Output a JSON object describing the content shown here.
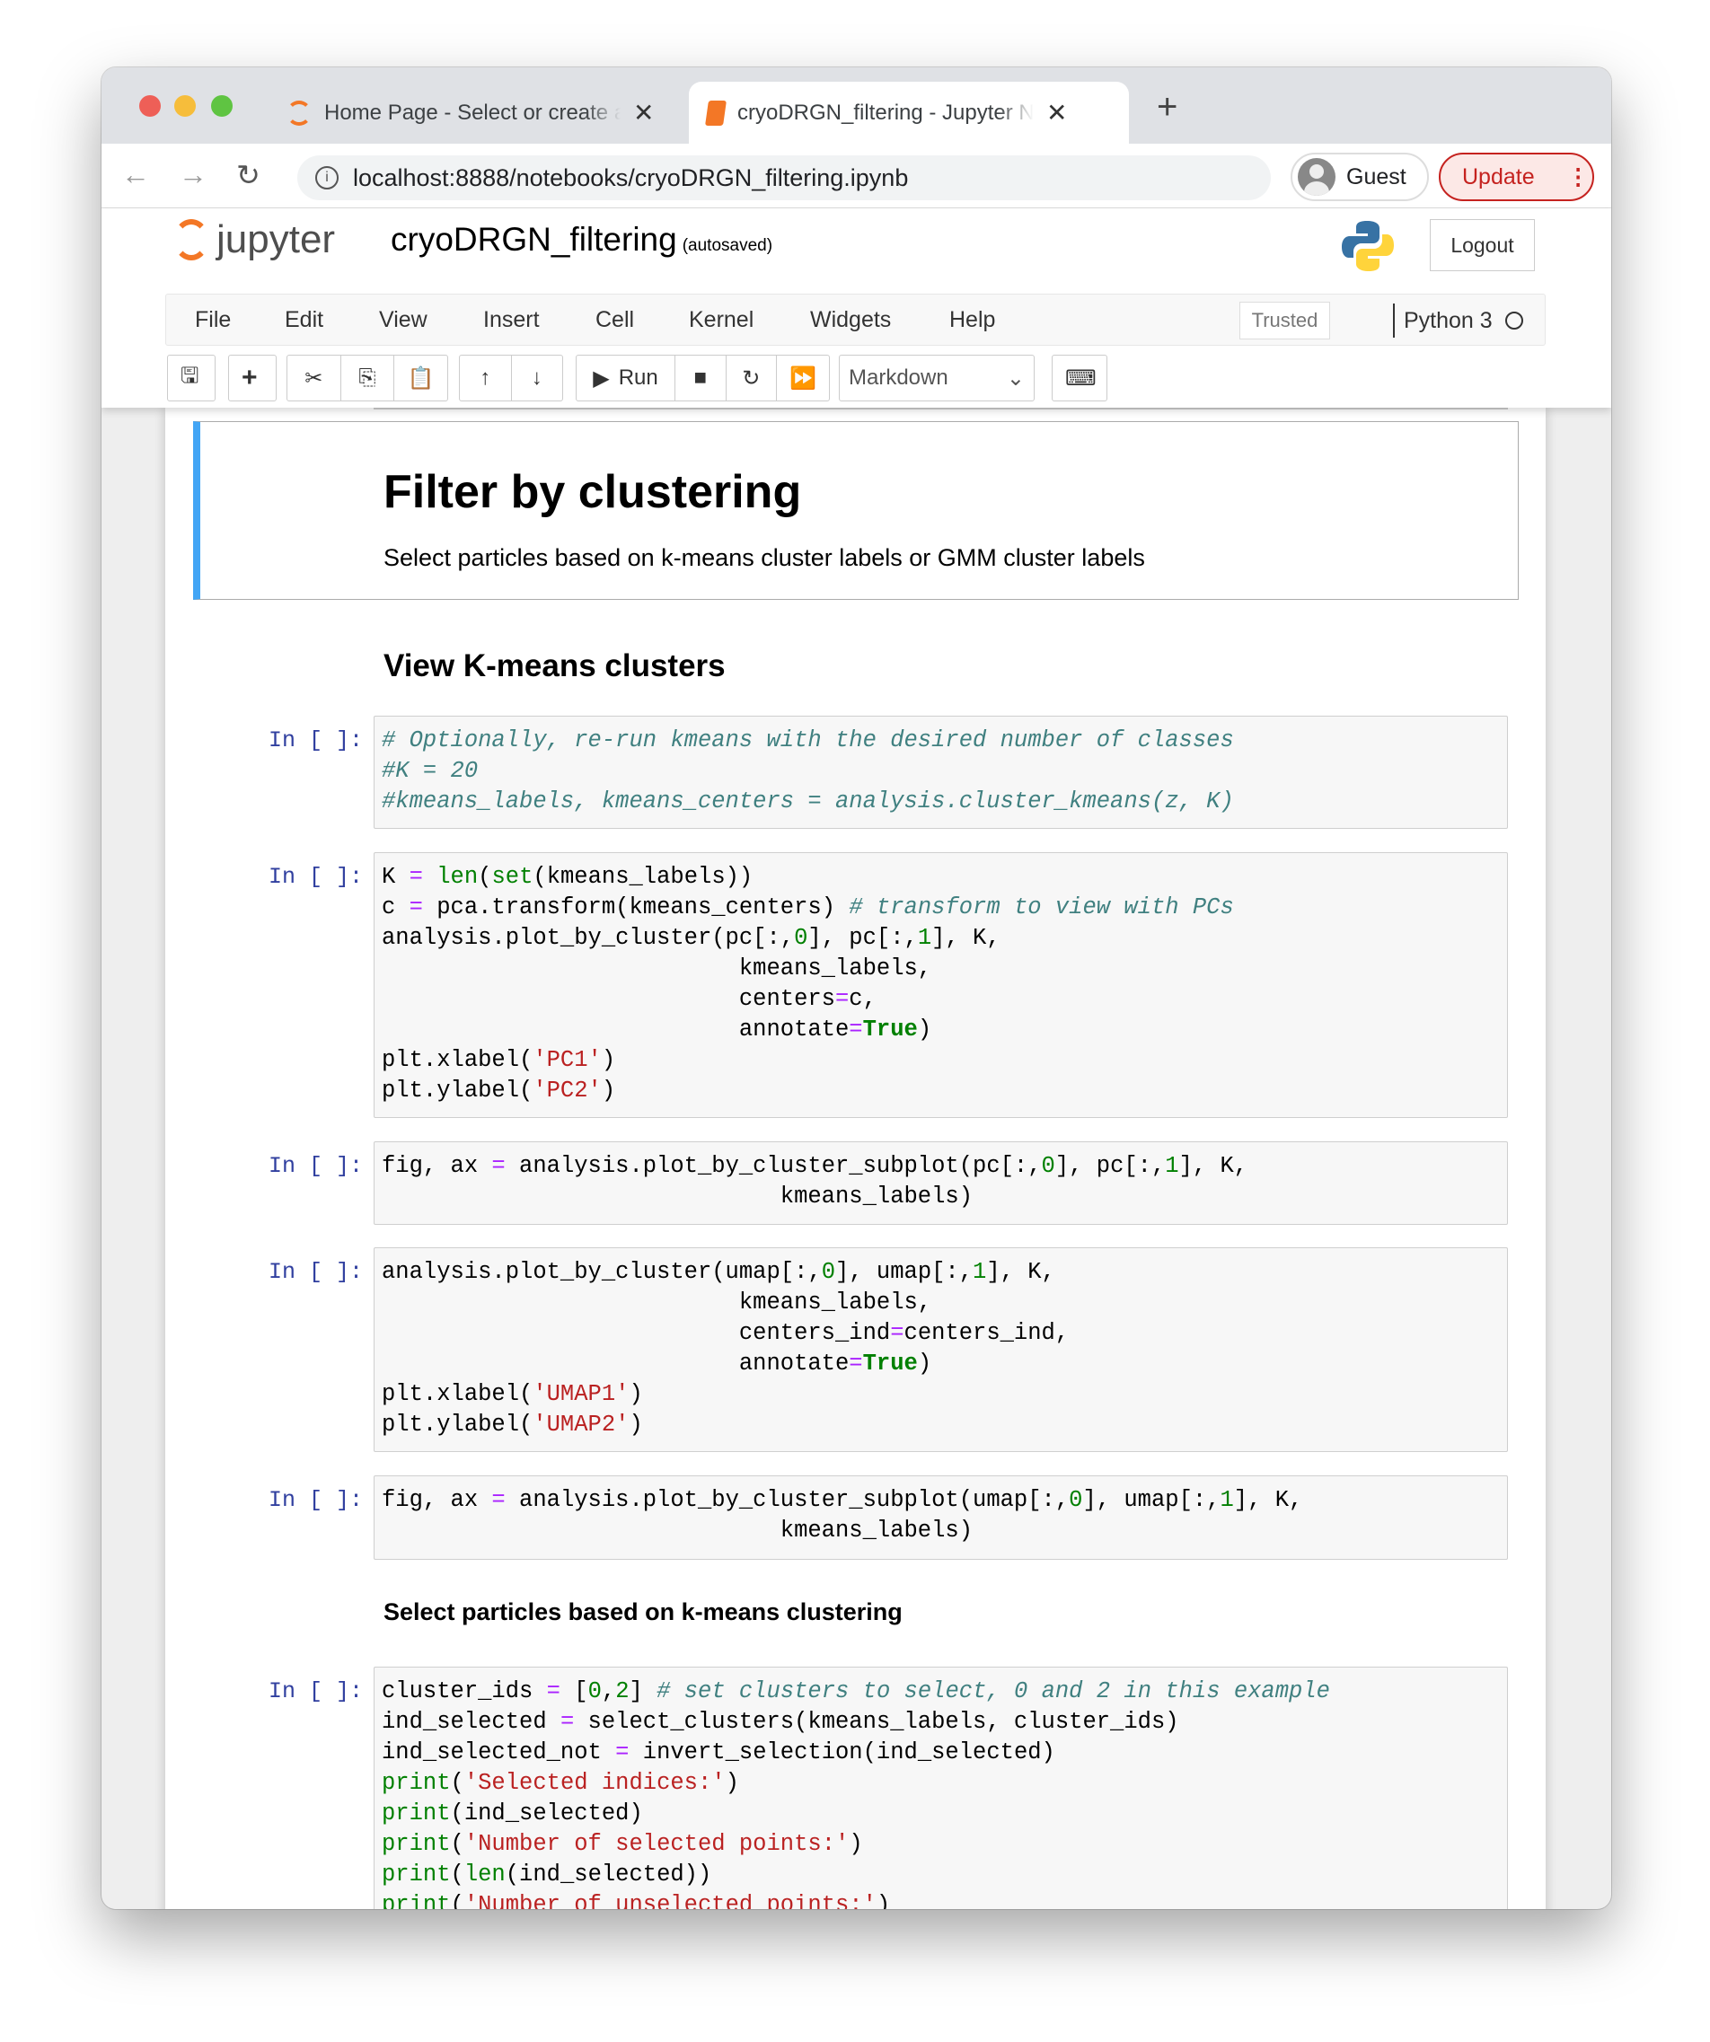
{
  "browser": {
    "tabs": [
      {
        "title": "Home Page - Select or create a notebook",
        "close": "✕"
      },
      {
        "title": "cryoDRGN_filtering - Jupyter Notebook",
        "close": "✕"
      }
    ],
    "new_tab": "+",
    "url": "localhost:8888/notebooks/cryoDRGN_filtering.ipynb",
    "profile": "Guest",
    "update": "Update",
    "nav": {
      "back": "←",
      "forward": "→",
      "reload": "↻",
      "menu": "⋮"
    }
  },
  "jupyter": {
    "logo_text": "jupyter",
    "notebook_name": "cryoDRGN_filtering",
    "save_status": "(autosaved)",
    "logout": "Logout",
    "menu": [
      "File",
      "Edit",
      "View",
      "Insert",
      "Cell",
      "Kernel",
      "Widgets",
      "Help"
    ],
    "trusted": "Trusted",
    "kernel": "Python 3",
    "toolbar": {
      "run": "Run",
      "cell_type": "Markdown"
    }
  },
  "colors": {
    "accent": "#42a5f5",
    "prompt": "#303f9f",
    "comment": "#408080",
    "string": "#ba2121",
    "builtin": "#008000",
    "operator": "#aa22ff",
    "update": "#c5221f"
  },
  "markdown": {
    "title": "Filter by clustering",
    "text": "Select particles based on k-means cluster labels or GMM cluster labels"
  },
  "headings": {
    "kmeans": "View K-means clusters",
    "select": "Select particles based on k-means clustering"
  },
  "prompt": "In [ ]:",
  "cells": [
    {
      "lines": [
        [
          [
            "c",
            "# Optionally, re-run kmeans with the desired number of classes"
          ]
        ],
        [
          [
            "c",
            "#K = 20"
          ]
        ],
        [
          [
            "c",
            "#kmeans_labels, kmeans_centers = analysis.cluster_kmeans(z, K)"
          ]
        ]
      ]
    },
    {
      "lines": [
        [
          [
            "n",
            "K "
          ],
          [
            "o",
            "="
          ],
          [
            "n",
            " "
          ],
          [
            "bi",
            "len"
          ],
          [
            "n",
            "("
          ],
          [
            "bi",
            "set"
          ],
          [
            "n",
            "(kmeans_labels))"
          ]
        ],
        [
          [
            "n",
            "c "
          ],
          [
            "o",
            "="
          ],
          [
            "n",
            " pca.transform(kmeans_centers) "
          ],
          [
            "c",
            "# transform to view with PCs"
          ]
        ],
        [
          [
            "n",
            "analysis.plot_by_cluster(pc[:,"
          ],
          [
            "m",
            "0"
          ],
          [
            "n",
            "], pc[:,"
          ],
          [
            "m",
            "1"
          ],
          [
            "n",
            "], K,"
          ]
        ],
        [
          [
            "n",
            "                          kmeans_labels,"
          ]
        ],
        [
          [
            "n",
            "                          centers"
          ],
          [
            "o",
            "="
          ],
          [
            "n",
            "c,"
          ]
        ],
        [
          [
            "n",
            "                          annotate"
          ],
          [
            "o",
            "="
          ],
          [
            "k",
            "True"
          ],
          [
            "n",
            ")"
          ]
        ],
        [
          [
            "n",
            "plt.xlabel("
          ],
          [
            "s",
            "'PC1'"
          ],
          [
            "n",
            ")"
          ]
        ],
        [
          [
            "n",
            "plt.ylabel("
          ],
          [
            "s",
            "'PC2'"
          ],
          [
            "n",
            ")"
          ]
        ]
      ]
    },
    {
      "lines": [
        [
          [
            "n",
            "fig, ax "
          ],
          [
            "o",
            "="
          ],
          [
            "n",
            " analysis.plot_by_cluster_subplot(pc[:,"
          ],
          [
            "m",
            "0"
          ],
          [
            "n",
            "], pc[:,"
          ],
          [
            "m",
            "1"
          ],
          [
            "n",
            "], K,"
          ]
        ],
        [
          [
            "n",
            "                             kmeans_labels)"
          ]
        ]
      ]
    },
    {
      "lines": [
        [
          [
            "n",
            "analysis.plot_by_cluster(umap[:,"
          ],
          [
            "m",
            "0"
          ],
          [
            "n",
            "], umap[:,"
          ],
          [
            "m",
            "1"
          ],
          [
            "n",
            "], K,"
          ]
        ],
        [
          [
            "n",
            "                          kmeans_labels,"
          ]
        ],
        [
          [
            "n",
            "                          centers_ind"
          ],
          [
            "o",
            "="
          ],
          [
            "n",
            "centers_ind,"
          ]
        ],
        [
          [
            "n",
            "                          annotate"
          ],
          [
            "o",
            "="
          ],
          [
            "k",
            "True"
          ],
          [
            "n",
            ")"
          ]
        ],
        [
          [
            "n",
            "plt.xlabel("
          ],
          [
            "s",
            "'UMAP1'"
          ],
          [
            "n",
            ")"
          ]
        ],
        [
          [
            "n",
            "plt.ylabel("
          ],
          [
            "s",
            "'UMAP2'"
          ],
          [
            "n",
            ")"
          ]
        ]
      ]
    },
    {
      "lines": [
        [
          [
            "n",
            "fig, ax "
          ],
          [
            "o",
            "="
          ],
          [
            "n",
            " analysis.plot_by_cluster_subplot(umap[:,"
          ],
          [
            "m",
            "0"
          ],
          [
            "n",
            "], umap[:,"
          ],
          [
            "m",
            "1"
          ],
          [
            "n",
            "], K,"
          ]
        ],
        [
          [
            "n",
            "                             kmeans_labels)"
          ]
        ]
      ]
    },
    {
      "lines": [
        [
          [
            "n",
            "cluster_ids "
          ],
          [
            "o",
            "="
          ],
          [
            "n",
            " ["
          ],
          [
            "m",
            "0"
          ],
          [
            "n",
            ","
          ],
          [
            "m",
            "2"
          ],
          [
            "n",
            "] "
          ],
          [
            "c",
            "# set clusters to select, 0 and 2 in this example"
          ]
        ],
        [
          [
            "n",
            "ind_selected "
          ],
          [
            "o",
            "="
          ],
          [
            "n",
            " select_clusters(kmeans_labels, cluster_ids)"
          ]
        ],
        [
          [
            "n",
            "ind_selected_not "
          ],
          [
            "o",
            "="
          ],
          [
            "n",
            " invert_selection(ind_selected)"
          ]
        ],
        [
          [
            "bi",
            "print"
          ],
          [
            "n",
            "("
          ],
          [
            "s",
            "'Selected indices:'"
          ],
          [
            "n",
            ")"
          ]
        ],
        [
          [
            "bi",
            "print"
          ],
          [
            "n",
            "(ind_selected)"
          ]
        ],
        [
          [
            "bi",
            "print"
          ],
          [
            "n",
            "("
          ],
          [
            "s",
            "'Number of selected points:'"
          ],
          [
            "n",
            ")"
          ]
        ],
        [
          [
            "bi",
            "print"
          ],
          [
            "n",
            "("
          ],
          [
            "bi",
            "len"
          ],
          [
            "n",
            "(ind_selected))"
          ]
        ],
        [
          [
            "bi",
            "print"
          ],
          [
            "n",
            "("
          ],
          [
            "s",
            "'Number of unselected points:'"
          ],
          [
            "n",
            ")"
          ]
        ]
      ]
    }
  ]
}
